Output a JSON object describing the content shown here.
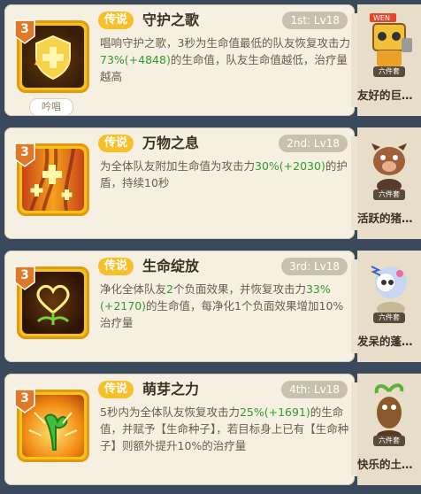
{
  "skills": [
    {
      "level": "3",
      "tag": "传说",
      "name": "守护之歌",
      "rank": "1st: Lv18",
      "desc_parts": [
        "唱响守护之歌，3秒为生命值最低的队友恢复攻击力",
        "73%(+4848)",
        "的生命值，队友生命值越低，治疗量越高"
      ],
      "extra_label": "吟唱"
    },
    {
      "level": "3",
      "tag": "传说",
      "name": "万物之息",
      "rank": "2nd: Lv18",
      "desc_parts": [
        "为全体队友附加生命值为攻击力",
        "30%(+2030)",
        "的护盾，持续10秒"
      ]
    },
    {
      "level": "3",
      "tag": "传说",
      "name": "生命绽放",
      "rank": "3rd: Lv18",
      "desc_parts": [
        "净化全体队友",
        "2",
        "个负面效果，并恢复攻击力",
        "33%(+2170)",
        "的生命值，每净化1个负面效果增加10%治疗量"
      ]
    },
    {
      "level": "3",
      "tag": "传说",
      "name": "萌芽之力",
      "rank": "4th: Lv18",
      "desc_parts": [
        "5秒内为全体队友恢复攻击力",
        "25%(+1691)",
        "的生命值，并赋予【生命种子】，若目标身上已有【生命种子】则额外提升10%的治疗量"
      ]
    }
  ],
  "side_cards": [
    {
      "badge": "六件套",
      "name": "友好的巨…",
      "banner": "WEN",
      "icon": "robot-figure-icon"
    },
    {
      "badge": "六件套",
      "name": "活跃的猪…",
      "icon": "boar-figure-icon"
    },
    {
      "badge": "六件套",
      "name": "发呆的蓬…",
      "icon": "fluffy-creature-figure-icon"
    },
    {
      "badge": "六件套",
      "name": "快乐的土…",
      "icon": "sprout-creature-figure-icon"
    }
  ],
  "colors": {
    "tag_bg": "#f7c02a",
    "highlight_green": "#2e9e2a",
    "card_bg": "#f6f0e2",
    "rank_bg": "#c9c1b0"
  }
}
